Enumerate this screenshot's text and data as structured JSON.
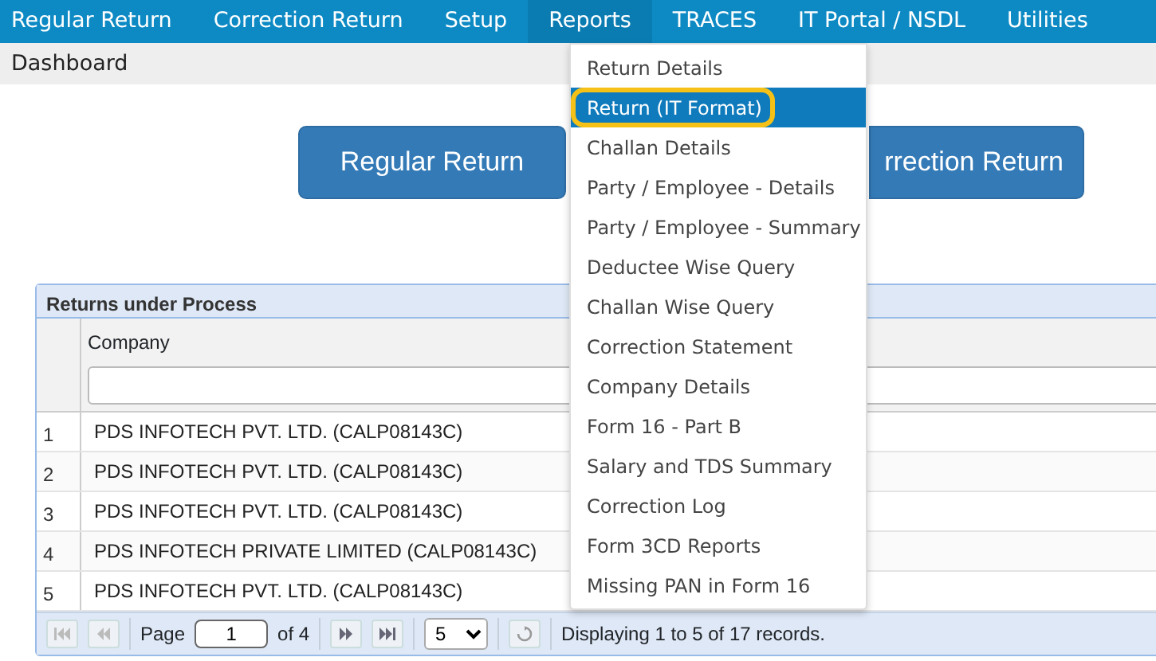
{
  "nav": [
    {
      "label": "Regular Return",
      "open": false
    },
    {
      "label": "Correction Return",
      "open": false
    },
    {
      "label": "Setup",
      "open": false
    },
    {
      "label": "Reports",
      "open": true
    },
    {
      "label": "TRACES",
      "open": false
    },
    {
      "label": "IT Portal / NSDL",
      "open": false
    },
    {
      "label": "Utilities",
      "open": false
    }
  ],
  "breadcrumb": "Dashboard",
  "buttons": [
    "Regular Return",
    "rrection Return"
  ],
  "grid": {
    "title": "Returns under Process",
    "columns": [
      "Company"
    ],
    "rows": [
      {
        "index": "1",
        "company": "PDS INFOTECH PVT. LTD. (CALP08143C)"
      },
      {
        "index": "2",
        "company": "PDS INFOTECH PVT. LTD. (CALP08143C)"
      },
      {
        "index": "3",
        "company": "PDS INFOTECH PVT. LTD. (CALP08143C)"
      },
      {
        "index": "4",
        "company": "PDS INFOTECH PRIVATE LIMITED (CALP08143C)"
      },
      {
        "index": "5",
        "company": "PDS INFOTECH PVT. LTD. (CALP08143C)"
      }
    ],
    "pager": {
      "page_label": "Page",
      "page": "1",
      "of": "of 4",
      "page_size": "5",
      "status": "Displaying 1 to 5 of 17 records."
    }
  },
  "menu": [
    {
      "label": "Return Details",
      "selected": false,
      "circled": false
    },
    {
      "label": "Return (IT Format)",
      "selected": true,
      "circled": true
    },
    {
      "label": "Challan Details",
      "selected": false,
      "circled": false
    },
    {
      "label": "Party / Employee - Details",
      "selected": false,
      "circled": false
    },
    {
      "label": "Party / Employee - Summary",
      "selected": false,
      "circled": false
    },
    {
      "label": "Deductee Wise Query",
      "selected": false,
      "circled": false
    },
    {
      "label": "Challan Wise Query",
      "selected": false,
      "circled": false
    },
    {
      "label": "Correction Statement",
      "selected": false,
      "circled": false
    },
    {
      "label": "Company Details",
      "selected": false,
      "circled": false
    },
    {
      "label": "Form 16 - Part B",
      "selected": false,
      "circled": false
    },
    {
      "label": "Salary and TDS Summary",
      "selected": false,
      "circled": false
    },
    {
      "label": "Correction Log",
      "selected": false,
      "circled": false
    },
    {
      "label": "Form 3CD Reports",
      "selected": false,
      "circled": false
    },
    {
      "label": "Missing PAN in Form 16",
      "selected": false,
      "circled": false
    }
  ]
}
